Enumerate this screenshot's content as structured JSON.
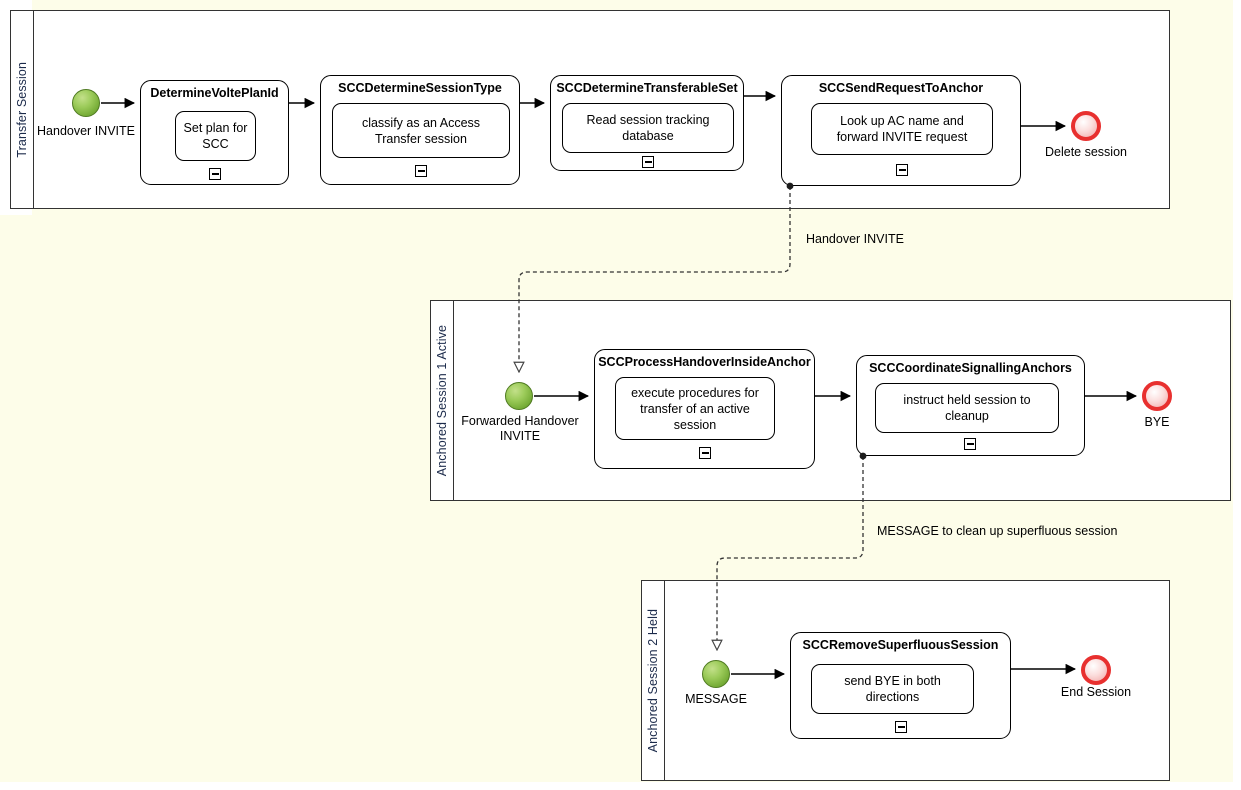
{
  "diagram": {
    "title": "SCC Access Transfer handover BPMN collaboration",
    "canvas_background": "#fdfde9",
    "pool_background": "#ffffff",
    "start_event_color": "#8cc152",
    "end_event_color": "#e8302f"
  },
  "pools": [
    {
      "id": "transfer-session",
      "lane_label": "Transfer Session",
      "start_event": {
        "label": "Handover INVITE",
        "icon": "start-event-icon"
      },
      "end_event": {
        "label": "Delete session",
        "icon": "end-event-icon"
      },
      "tasks": [
        {
          "title": "DetermineVoltePlanId",
          "body": "Set plan for SCC",
          "marker": "collapse-minus-icon"
        },
        {
          "title": "SCCDetermineSessionType",
          "body": "classify as an Access Transfer session",
          "marker": "collapse-minus-icon"
        },
        {
          "title": "SCCDetermineTransferableSet",
          "body": "Read session tracking database",
          "marker": "collapse-minus-icon"
        },
        {
          "title": "SCCSendRequestToAnchor",
          "body": "Look up AC name and forward INVITE request",
          "marker": "collapse-minus-icon"
        }
      ]
    },
    {
      "id": "anchored-session-1-active",
      "lane_label": "Anchored Session 1 Active",
      "start_event": {
        "label": "Forwarded Handover INVITE",
        "icon": "start-event-icon"
      },
      "end_event": {
        "label": "BYE",
        "icon": "end-event-icon"
      },
      "tasks": [
        {
          "title": "SCCProcessHandoverInsideAnchor",
          "body": "execute procedures for transfer of an active session",
          "marker": "collapse-minus-icon"
        },
        {
          "title": "SCCCoordinateSignallingAnchors",
          "body": "instruct held session to cleanup",
          "marker": "collapse-minus-icon"
        }
      ]
    },
    {
      "id": "anchored-session-2-held",
      "lane_label": "Anchored Session 2 Held",
      "start_event": {
        "label": "MESSAGE",
        "icon": "start-event-icon"
      },
      "end_event": {
        "label": "End Session",
        "icon": "end-event-icon"
      },
      "tasks": [
        {
          "title": "SCCRemoveSuperfluousSession",
          "body": "send BYE in both directions",
          "marker": "collapse-minus-icon"
        }
      ]
    }
  ],
  "message_flows": [
    {
      "label": "Handover INVITE",
      "from": "SCCSendRequestToAnchor",
      "to": "Forwarded Handover INVITE"
    },
    {
      "label": "MESSAGE to clean up superfluous session",
      "from": "SCCCoordinateSignallingAnchors",
      "to": "MESSAGE"
    }
  ]
}
